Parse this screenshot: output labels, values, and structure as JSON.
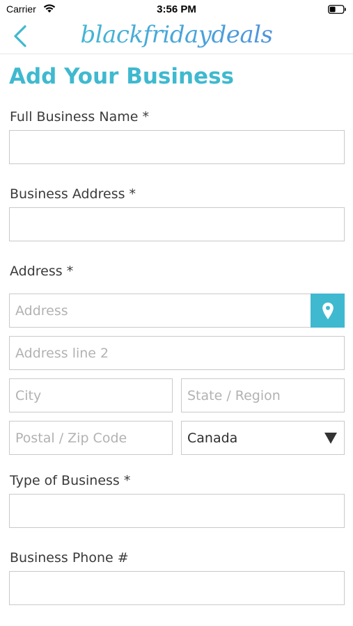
{
  "status_bar": {
    "carrier": "Carrier",
    "time": "3:56 PM"
  },
  "nav": {
    "brand": "blackfridaydeals",
    "back_icon": "chevron-left-icon"
  },
  "page": {
    "title": "Add Your Business"
  },
  "form": {
    "business_name_label": "Full Business Name *",
    "business_address_label": "Business Address *",
    "address_label": "Address *",
    "address_placeholder": "Address",
    "address2_placeholder": "Address line 2",
    "city_placeholder": "City",
    "state_placeholder": "State / Region",
    "postal_placeholder": "Postal / Zip Code",
    "country_value": "Canada",
    "type_label": "Type of Business *",
    "phone_label": "Business Phone #"
  },
  "colors": {
    "accent": "#3fb9cf",
    "border": "#c9c9c9",
    "text": "#3a3a3a",
    "placeholder": "#b2b2b2"
  }
}
